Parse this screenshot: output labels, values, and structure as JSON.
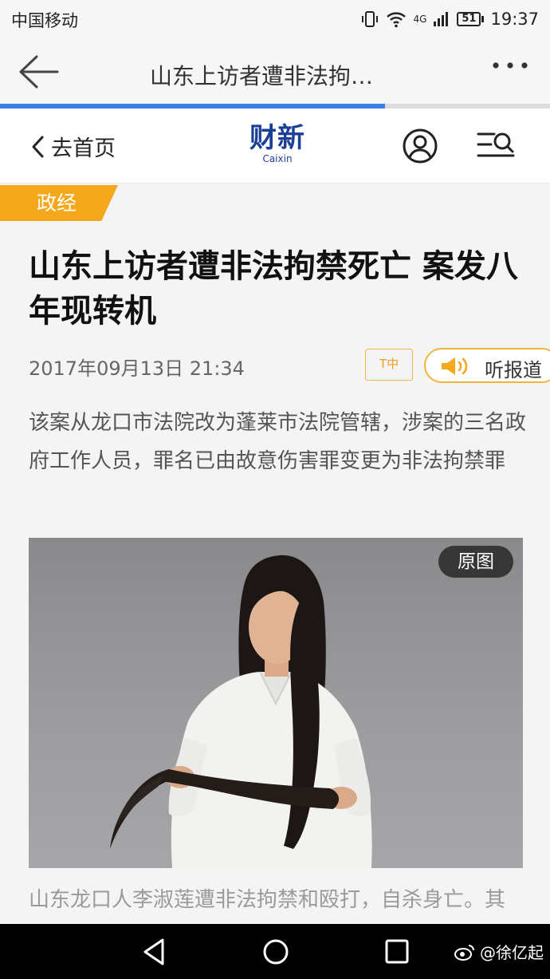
{
  "status_bar": {
    "carrier": "中国移动",
    "network": "4G",
    "battery": "51",
    "time": "19:37"
  },
  "toolbar": {
    "title": "山东上访者遭非法拘…",
    "progress_percent": 70
  },
  "site_header": {
    "home_label": "去首页",
    "logo_cn": "财新",
    "logo_en": "Caixin"
  },
  "article": {
    "category": "政经",
    "headline": "山东上访者遭非法拘禁死亡 案发八年现转机",
    "date": "2017年09月13日 21:34",
    "font_toggle": "T中",
    "listen_label": "听报道",
    "summary": "该案从龙口市法院改为蓬莱市法院管辖，涉案的三名政府工作人员，罪名已由故意伤害罪变更为非法拘禁罪",
    "photo_button": "原图",
    "caption": "山东龙口人李淑莲遭非法拘禁和殴打，自杀身亡。其女李文丛年来为母申冤，蓬发明志，图自"
  },
  "watermark": {
    "text": "@徐亿起"
  },
  "colors": {
    "accent_orange": "#f5a81c",
    "brand_blue": "#1b3f96",
    "progress_blue": "#3b7fe8"
  }
}
